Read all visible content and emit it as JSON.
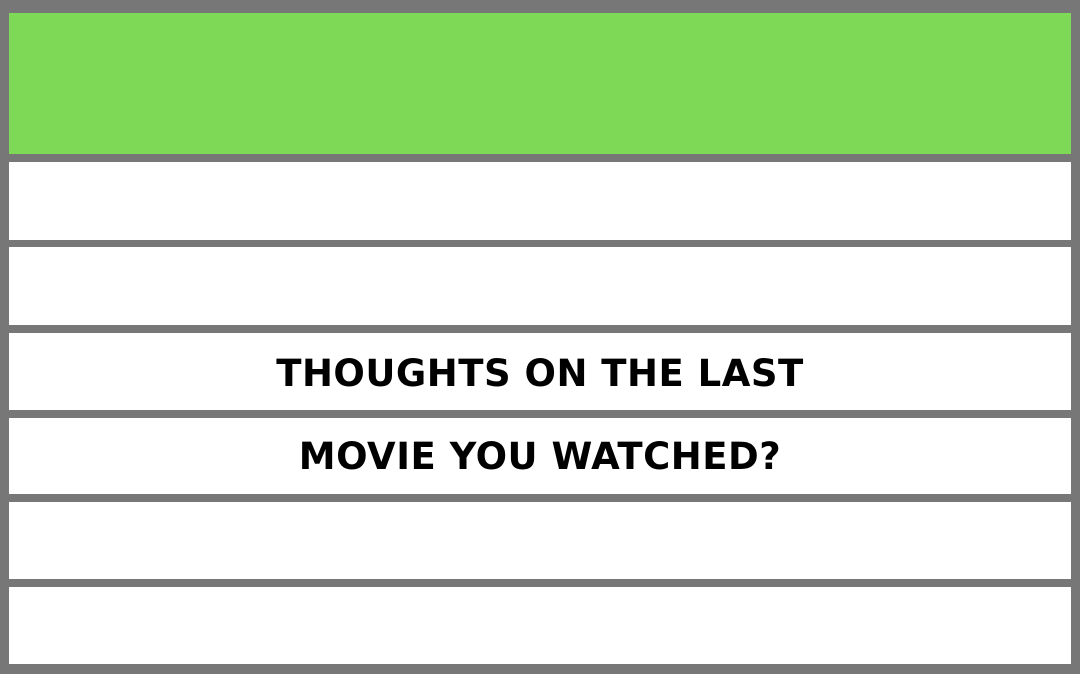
{
  "colors": {
    "border": "#777777",
    "header": "#7ed957",
    "row": "#ffffff",
    "text": "#000000"
  },
  "prompt": {
    "line1": "THOUGHTS ON THE LAST",
    "line2": "MOVIE YOU WATCHED?"
  }
}
